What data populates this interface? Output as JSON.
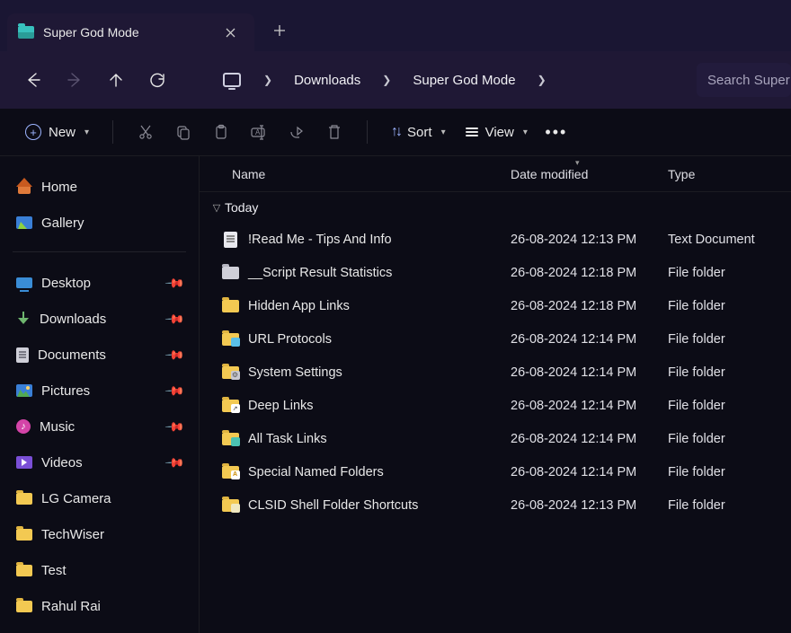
{
  "tab": {
    "title": "Super God Mode"
  },
  "breadcrumb": [
    "Downloads",
    "Super God Mode"
  ],
  "search_placeholder": "Search Super God Mode",
  "toolbar": {
    "new_label": "New",
    "sort_label": "Sort",
    "view_label": "View"
  },
  "sidebar": {
    "top": [
      {
        "label": "Home",
        "icon": "home"
      },
      {
        "label": "Gallery",
        "icon": "gallery"
      }
    ],
    "quick": [
      {
        "label": "Desktop",
        "icon": "desktop",
        "pinned": true
      },
      {
        "label": "Downloads",
        "icon": "down",
        "pinned": true
      },
      {
        "label": "Documents",
        "icon": "doc",
        "pinned": true
      },
      {
        "label": "Pictures",
        "icon": "pic",
        "pinned": true
      },
      {
        "label": "Music",
        "icon": "music",
        "pinned": true
      },
      {
        "label": "Videos",
        "icon": "video",
        "pinned": true
      },
      {
        "label": "LG Camera",
        "icon": "folder",
        "pinned": false
      },
      {
        "label": "TechWiser",
        "icon": "folder",
        "pinned": false
      },
      {
        "label": "Test",
        "icon": "folder",
        "pinned": false
      },
      {
        "label": "Rahul Rai",
        "icon": "folder",
        "pinned": false
      }
    ]
  },
  "columns": {
    "name": "Name",
    "date": "Date modified",
    "type": "Type"
  },
  "group_label": "Today",
  "files": [
    {
      "name": "!Read Me - Tips And Info",
      "date": "26-08-2024 12:13 PM",
      "type": "Text Document",
      "icon": "txt"
    },
    {
      "name": "__Script Result Statistics",
      "date": "26-08-2024 12:18 PM",
      "type": "File folder",
      "icon": "folder-plain"
    },
    {
      "name": "Hidden App Links",
      "date": "26-08-2024 12:18 PM",
      "type": "File folder",
      "icon": "folder-yellow"
    },
    {
      "name": "URL Protocols",
      "date": "26-08-2024 12:14 PM",
      "type": "File folder",
      "icon": "folder-blue"
    },
    {
      "name": "System Settings",
      "date": "26-08-2024 12:14 PM",
      "type": "File folder",
      "icon": "folder-gear"
    },
    {
      "name": "Deep Links",
      "date": "26-08-2024 12:14 PM",
      "type": "File folder",
      "icon": "folder-yellow-link"
    },
    {
      "name": "All Task Links",
      "date": "26-08-2024 12:14 PM",
      "type": "File folder",
      "icon": "folder-teal"
    },
    {
      "name": "Special Named Folders",
      "date": "26-08-2024 12:14 PM",
      "type": "File folder",
      "icon": "folder-a"
    },
    {
      "name": "CLSID Shell Folder Shortcuts",
      "date": "26-08-2024 12:13 PM",
      "type": "File folder",
      "icon": "folder-cream"
    }
  ]
}
